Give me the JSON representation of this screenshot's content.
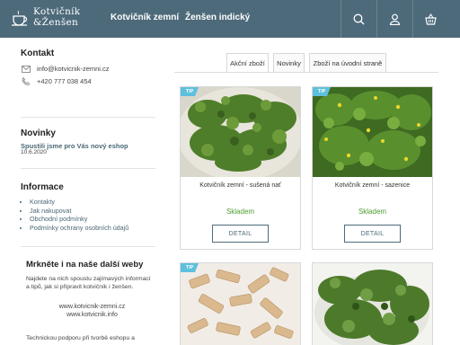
{
  "header": {
    "logo_line1": "Kotvičník",
    "logo_line2": "&Ženšen",
    "nav": [
      "Kotvičník zemní",
      "Ženšen indický"
    ],
    "icons": [
      "search-icon",
      "user-icon",
      "basket-icon"
    ]
  },
  "sidebar": {
    "contact": {
      "title": "Kontakt",
      "email": "info@kotvicnik-zemni.cz",
      "phone": "+420 777 038 454"
    },
    "news": {
      "title": "Novinky",
      "headline": "Spustili jsme pro Vás nový eshop",
      "date": "10.6.2020"
    },
    "info": {
      "title": "Informace",
      "items": [
        "Kontakty",
        "Jak nakupovat",
        "Obchodní podmínky",
        "Podmínky ochrany osobních údajů"
      ]
    },
    "webs": {
      "title": "Mrkněte i na naše další weby",
      "text": "Najdete na nich spoustu zajímavých informací a tipů, jak si připravit kotvičník i ženšen.",
      "links": [
        "www.kotvicnik-zemni.cz",
        "www.kotvicnik.info"
      ],
      "support": "Technickou podporu při tvorbě eshopu a"
    }
  },
  "tabs": [
    "Akční zboží",
    "Novinky",
    "Zboží na úvodní straně"
  ],
  "products": [
    {
      "name": "Kotvičník zemní - sušená nať",
      "stock": "Skladem",
      "button": "DETAIL",
      "badge": "TIP"
    },
    {
      "name": "Kotvičník zemní - sazenice",
      "stock": "Skladem",
      "button": "DETAIL",
      "badge": "TIP"
    },
    {
      "name": "",
      "stock": "",
      "button": "",
      "badge": "TIP"
    },
    {
      "name": "",
      "stock": "",
      "button": "",
      "badge": ""
    }
  ],
  "colors": {
    "header": "#4d6a7a",
    "accent": "#4a6876",
    "stock": "#4a9d2f",
    "tip": "#5ec0dd"
  }
}
